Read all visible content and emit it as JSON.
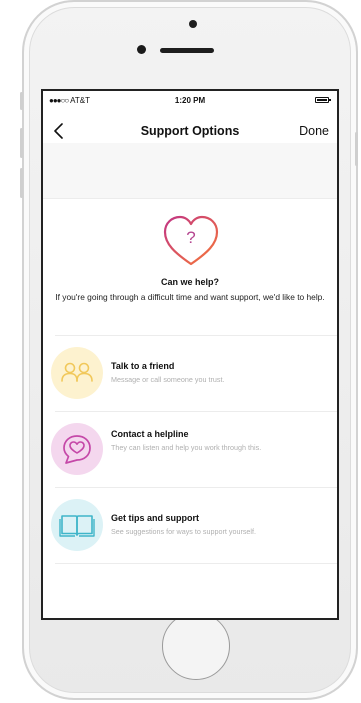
{
  "status_bar": {
    "carrier": "AT&T",
    "time": "1:20 PM"
  },
  "nav": {
    "back_icon": "chevron-left-icon",
    "title": "Support Options",
    "done_label": "Done"
  },
  "help": {
    "heart_glyph": "?",
    "title": "Can we help?",
    "description": "If you're going through a difficult time and want support, we'd like to help."
  },
  "options": [
    {
      "icon": "two-friends-icon",
      "title": "Talk to a friend",
      "subtitle": "Message or call someone you trust.",
      "icon_color": "#f1c85a",
      "bg_color": "#fdf2cf"
    },
    {
      "icon": "chat-heart-icon",
      "title": "Contact a helpline",
      "subtitle": "They can listen and help you work through this.",
      "icon_color": "#c548a8",
      "bg_color": "#f4d7ee"
    },
    {
      "icon": "open-book-icon",
      "title": "Get tips and support",
      "subtitle": "See suggestions for ways to support yourself.",
      "icon_color": "#3fb5c9",
      "bg_color": "#dcf2f6"
    }
  ],
  "colors": {
    "heart_gradient_start": "#c13584",
    "heart_gradient_end": "#f77737"
  }
}
